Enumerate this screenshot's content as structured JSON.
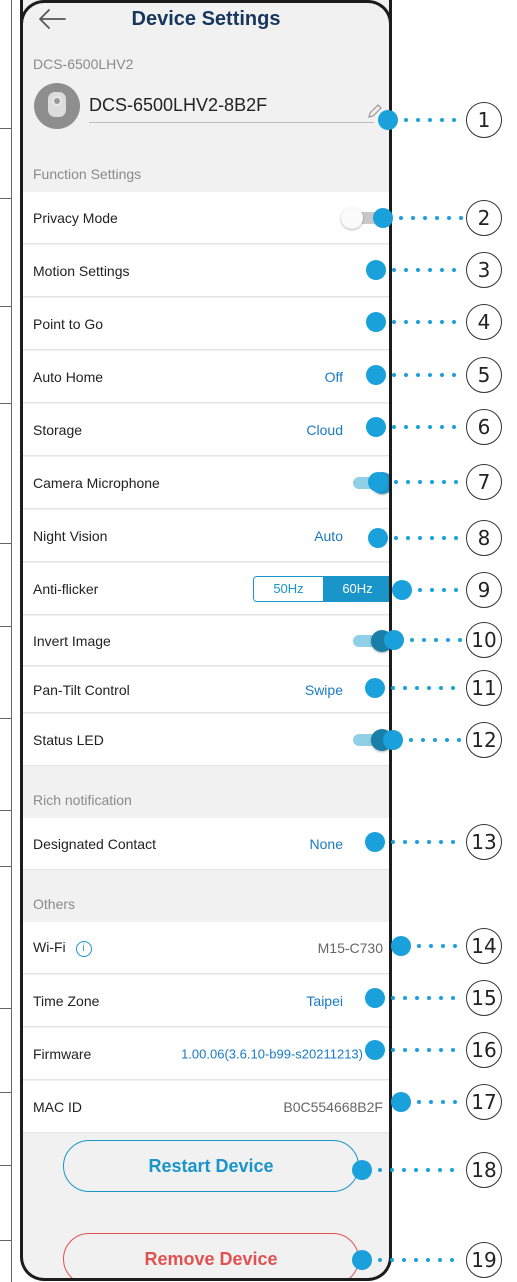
{
  "header": {
    "title": "Device Settings"
  },
  "device": {
    "model_label": "DCS-6500LHV2",
    "name": "DCS-6500LHV2-8B2F"
  },
  "sections": {
    "function": "Function Settings",
    "rich": "Rich notification",
    "others": "Others"
  },
  "settings": {
    "privacy_mode": {
      "label": "Privacy Mode",
      "on": false
    },
    "motion": {
      "label": "Motion Settings"
    },
    "point_to_go": {
      "label": "Point to Go"
    },
    "auto_home": {
      "label": "Auto Home",
      "value": "Off"
    },
    "storage": {
      "label": "Storage",
      "value": "Cloud"
    },
    "camera_mic": {
      "label": "Camera Microphone",
      "on": true
    },
    "night_vision": {
      "label": "Night Vision",
      "value": "Auto"
    },
    "anti_flicker": {
      "label": "Anti-flicker",
      "options": [
        "50Hz",
        "60Hz"
      ],
      "selected": "60Hz"
    },
    "invert_image": {
      "label": "Invert Image",
      "on": true
    },
    "pan_tilt": {
      "label": "Pan-Tilt Control",
      "value": "Swipe"
    },
    "status_led": {
      "label": "Status LED",
      "on": true
    }
  },
  "rich": {
    "contact_label": "Designated Contact",
    "contact_value": "None"
  },
  "others": {
    "wifi_label": "Wi-Fi",
    "wifi_value": "M15-C730",
    "timezone_label": "Time Zone",
    "timezone_value": "Taipei",
    "firmware_label": "Firmware",
    "firmware_value": "1.00.06(3.6.10-b99-s20211213)",
    "mac_label": "MAC ID",
    "mac_value": "B0C554668B2F"
  },
  "buttons": {
    "restart": "Restart Device",
    "remove": "Remove Device"
  },
  "callouts": [
    "1",
    "2",
    "3",
    "4",
    "5",
    "6",
    "7",
    "8",
    "9",
    "10",
    "11",
    "12",
    "13",
    "14",
    "15",
    "16",
    "17",
    "18",
    "19"
  ],
  "icons": {
    "back": "back-arrow-icon",
    "edit": "pencil-icon",
    "chevron": "chevron-right-icon",
    "info": "info-icon",
    "camera": "camera-icon"
  },
  "colors": {
    "accent": "#1a95c9",
    "title": "#17365d",
    "danger": "#e05252",
    "callout_dot": "#1aa0db"
  }
}
